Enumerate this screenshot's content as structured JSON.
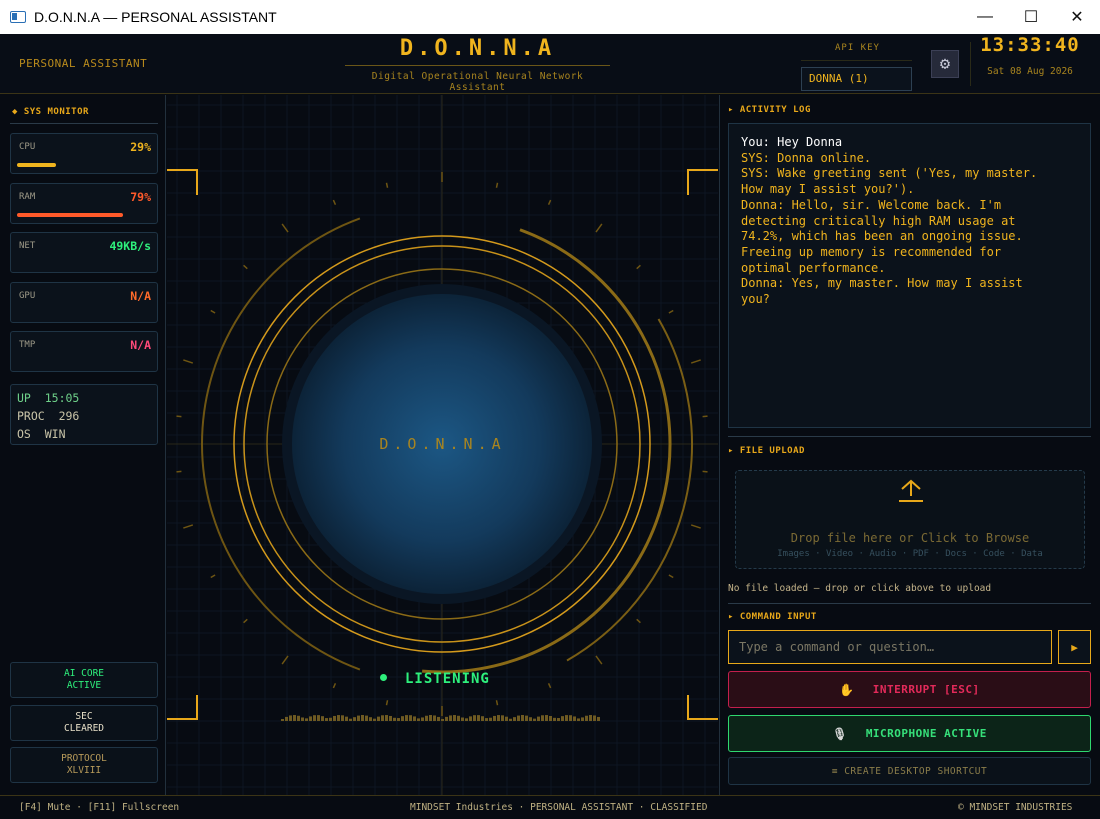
{
  "window": {
    "title": "D.O.N.N.A — PERSONAL ASSISTANT",
    "minimize": "—",
    "maximize": "☐",
    "close": "✕"
  },
  "header": {
    "tagline": "PERSONAL ASSISTANT",
    "brand": "D.O.N.N.A",
    "subtitle": "Digital Operational Neural Network Assistant",
    "api_label": "API KEY",
    "api_value": "DONNA (1)",
    "settings_icon": "gear-icon",
    "clock": "13:33:40",
    "date": "Sat 08 Aug 2026"
  },
  "sidebar": {
    "title": "◆ SYS MONITOR",
    "stats": [
      {
        "label": "CPU",
        "value": "29%",
        "color": "#f0b41e",
        "fill": 0.29
      },
      {
        "label": "RAM",
        "value": "79%",
        "color": "#ff5a2a",
        "fill": 0.79
      },
      {
        "label": "NET",
        "value": "49KB/s",
        "color": "#2ef07c"
      },
      {
        "label": "GPU",
        "value": "N/A",
        "color": "#ff6a2a"
      },
      {
        "label": "TMP",
        "value": "N/A",
        "color": "#ff4a7a"
      }
    ],
    "info": [
      {
        "key": "UP",
        "value": "15:05"
      },
      {
        "key": "PROC",
        "value": "296"
      },
      {
        "key": "OS",
        "value": "WIN"
      }
    ],
    "status": [
      {
        "line1": "AI CORE",
        "line2": "ACTIVE",
        "color": "#2ef07c"
      },
      {
        "line1": "SEC",
        "line2": "CLEARED",
        "color": "#e8e0c8"
      },
      {
        "line1": "PROTOCOL",
        "line2": "XLVIII",
        "color": "#b89b5a"
      }
    ]
  },
  "center": {
    "core_label": "D.O.N.N.A",
    "status": "LISTENING",
    "status_color": "#2ef07c"
  },
  "activity": {
    "title": "▸ ACTIVITY LOG",
    "lines": [
      {
        "who": "You",
        "text": "You: Hey Donna"
      },
      {
        "who": "SYS",
        "text": "SYS: Donna online."
      },
      {
        "who": "SYS",
        "text": "SYS: Wake greeting sent ('Yes, my master.\nHow may I assist you?')."
      },
      {
        "who": "Donna",
        "text": "Donna: Hello, sir. Welcome back. I'm\ndetecting critically high RAM usage at\n74.2%, which has been an ongoing issue.\nFreeing up memory is recommended for\noptimal performance."
      },
      {
        "who": "Donna",
        "text": "Donna: Yes, my master. How may I assist\nyou?"
      }
    ]
  },
  "upload": {
    "title": "▸ FILE UPLOAD",
    "icon": "upload-icon",
    "main": "Drop file here  or  Click to Browse",
    "types": "Images · Video · Audio · PDF · Docs · Code · Data",
    "status": "No file loaded — drop or click above to upload"
  },
  "command": {
    "title": "▸ COMMAND INPUT",
    "placeholder": "Type a command or question…",
    "send": "▶",
    "interrupt_icon": "hand-icon",
    "interrupt": "INTERRUPT  [ESC]",
    "mic_icon": "microphone-icon",
    "mic": "MICROPHONE ACTIVE",
    "shortcut": "≡  CREATE DESKTOP SHORTCUT"
  },
  "footer": {
    "left": "[F4] Mute  ·  [F11] Fullscreen",
    "center": "MINDSET Industries  ·  PERSONAL ASSISTANT  ·  CLASSIFIED",
    "right": "© MINDSET INDUSTRIES"
  }
}
